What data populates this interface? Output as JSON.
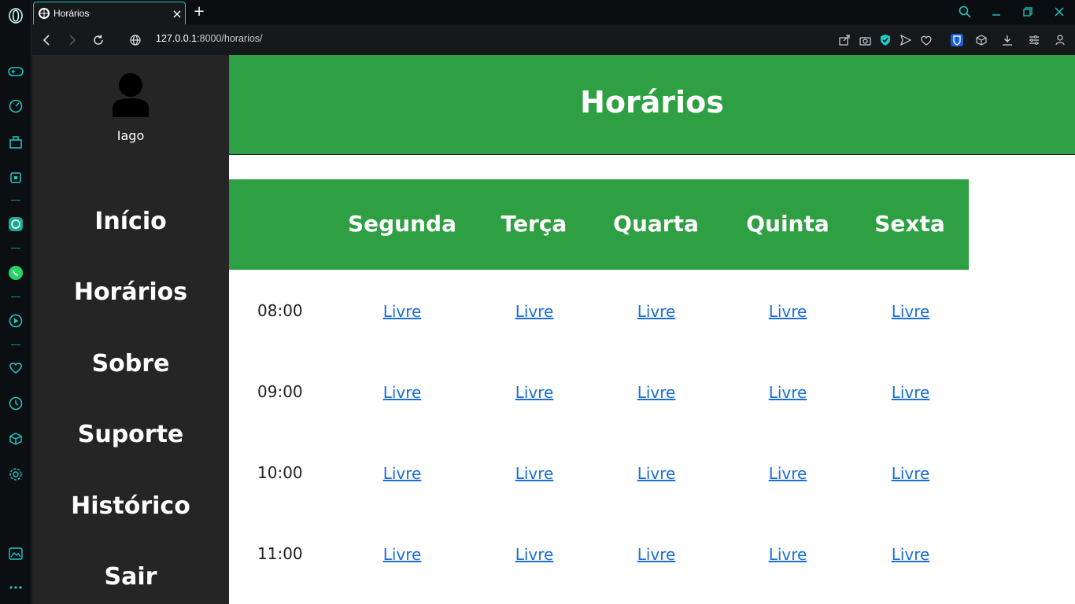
{
  "browser": {
    "tab_title": "Horários",
    "url_host": "127.0.0.1",
    "url_rest": ":8000/horarios/",
    "new_tab": "+"
  },
  "colors": {
    "accent": "#2ea043",
    "sidebar": "#252525",
    "link": "#1a6ed8",
    "browser_accent": "#1fc9c6"
  },
  "user": {
    "name": "Iago"
  },
  "menu": [
    "Início",
    "Horários",
    "Sobre",
    "Suporte",
    "Histórico",
    "Sair"
  ],
  "page_title": "Horários",
  "schedule": {
    "days": [
      "Segunda",
      "Terça",
      "Quarta",
      "Quinta",
      "Sexta"
    ],
    "rows": [
      {
        "time": "08:00",
        "slots": [
          "Livre",
          "Livre",
          "Livre",
          "Livre",
          "Livre"
        ]
      },
      {
        "time": "09:00",
        "slots": [
          "Livre",
          "Livre",
          "Livre",
          "Livre",
          "Livre"
        ]
      },
      {
        "time": "10:00",
        "slots": [
          "Livre",
          "Livre",
          "Livre",
          "Livre",
          "Livre"
        ]
      },
      {
        "time": "11:00",
        "slots": [
          "Livre",
          "Livre",
          "Livre",
          "Livre",
          "Livre"
        ]
      }
    ]
  }
}
